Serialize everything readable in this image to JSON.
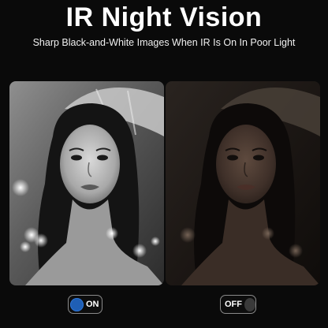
{
  "header": {
    "title": "IR Night Vision",
    "subtitle": "Sharp Black-and-White Images When IR Is On In Poor Light"
  },
  "panels": [
    {
      "mode": "IR on - black and white",
      "tint": "#bdbdbd"
    },
    {
      "mode": "IR off - dim color",
      "tint": "#5a4030"
    }
  ],
  "toggles": {
    "on": {
      "label": "ON",
      "state": true,
      "color": "#1f5fb5"
    },
    "off": {
      "label": "OFF",
      "state": false,
      "color": "#3a3a3a"
    }
  }
}
